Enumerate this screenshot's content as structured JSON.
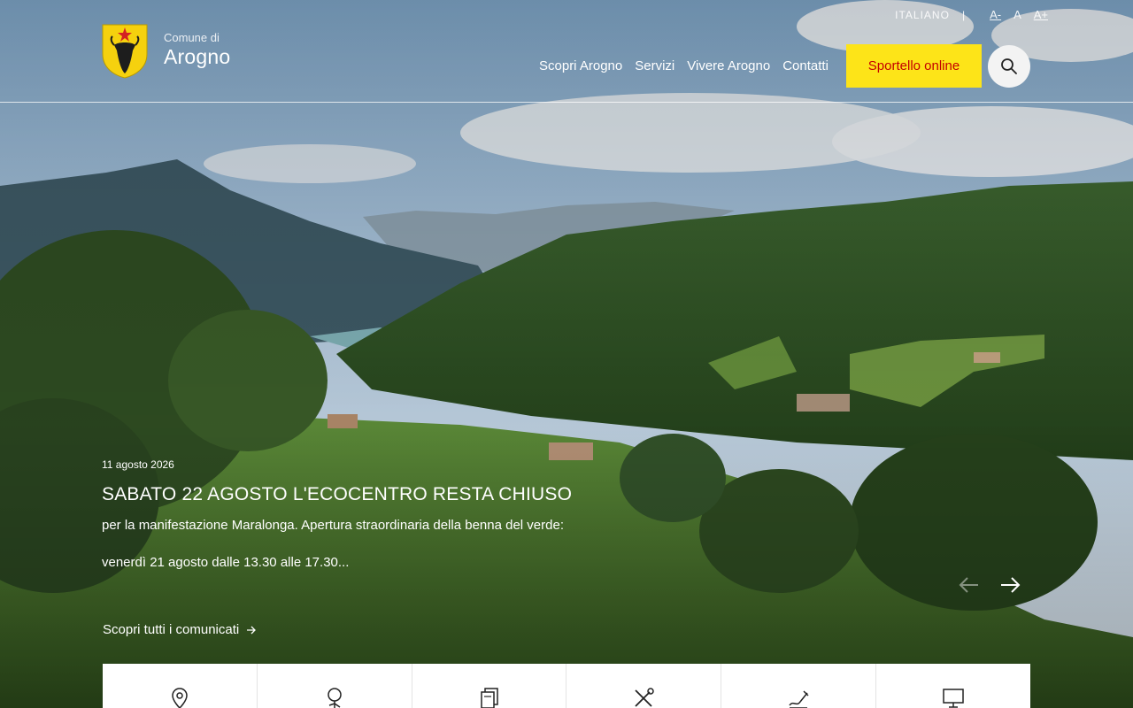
{
  "header": {
    "logo_small": "Comune di",
    "logo_big": "Arogno",
    "lang": "ITALIANO",
    "font_sizes": [
      "A-",
      "A",
      "A+"
    ],
    "nav": [
      "Scopri Arogno",
      "Servizi",
      "Vivere Arogno",
      "Contatti"
    ],
    "cta": "Sportello online",
    "search_icon": "search-icon"
  },
  "slide": {
    "date": "11 agosto 2026",
    "title": "SABATO 22 AGOSTO L'ECOCENTRO RESTA CHIUSO",
    "text1": "per la manifestazione Maralonga. Apertura straordinaria della benna del verde:",
    "text2": "venerdì 21 agosto dalle 13.30 alle 17.30..."
  },
  "all_link": "Scopri tutti i comunicati",
  "quick_icons": [
    "location-pin-icon",
    "tree-icon",
    "documents-icon",
    "tools-icon",
    "signature-icon",
    "monitor-icon"
  ],
  "colors": {
    "cta_bg": "#fde418",
    "cta_text": "#c40000"
  }
}
